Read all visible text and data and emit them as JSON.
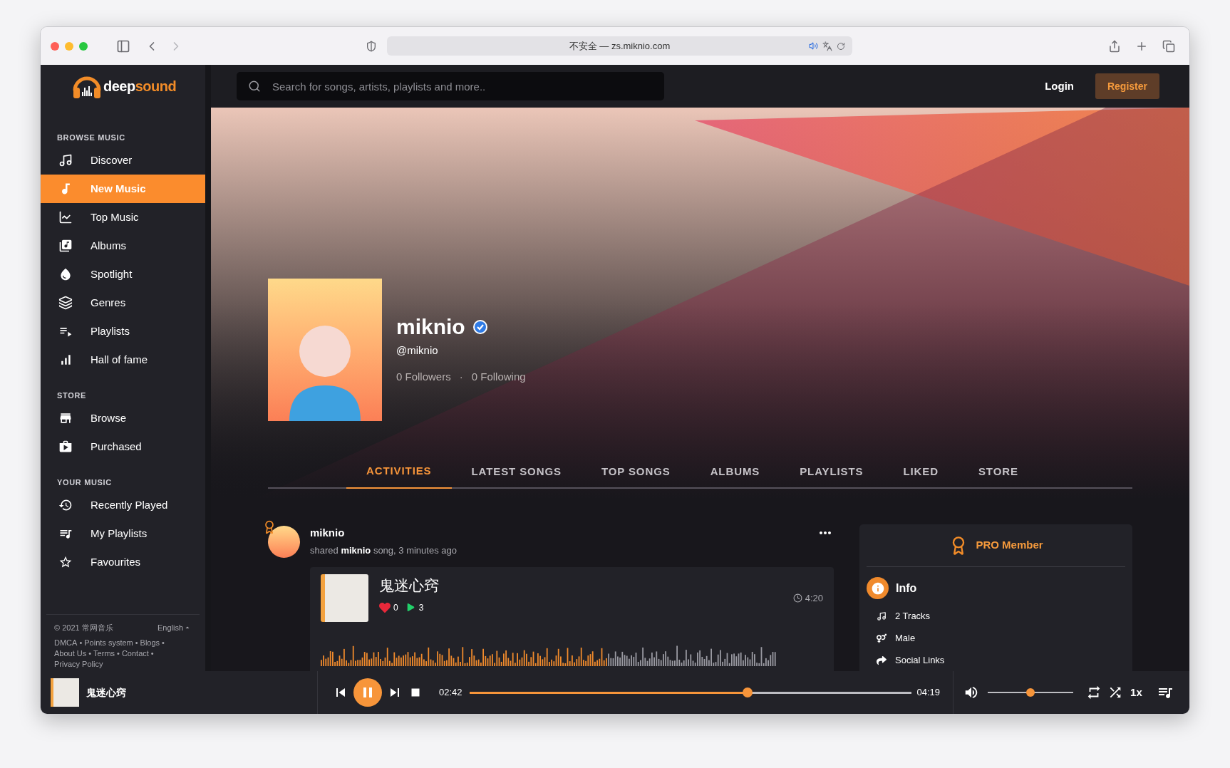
{
  "browser": {
    "address": "不安全 — zs.miknio.com"
  },
  "header": {
    "logo_a": "deep",
    "logo_b": "sound",
    "search": {
      "placeholder": "Search for songs, artists, playlists and more.."
    },
    "login": "Login",
    "register": "Register"
  },
  "sidebar": {
    "sections": [
      {
        "heading": "BROWSE MUSIC",
        "items": [
          {
            "label": "Discover",
            "selected": false
          },
          {
            "label": "New Music",
            "selected": true
          },
          {
            "label": "Top Music",
            "selected": false
          },
          {
            "label": "Albums",
            "selected": false
          },
          {
            "label": "Spotlight",
            "selected": false
          },
          {
            "label": "Genres",
            "selected": false
          },
          {
            "label": "Playlists",
            "selected": false
          },
          {
            "label": "Hall of fame",
            "selected": false
          }
        ]
      },
      {
        "heading": "STORE",
        "items": [
          {
            "label": "Browse",
            "selected": false
          },
          {
            "label": "Purchased",
            "selected": false
          }
        ]
      },
      {
        "heading": "YOUR MUSIC",
        "items": [
          {
            "label": "Recently Played",
            "selected": false
          },
          {
            "label": "My Playlists",
            "selected": false
          },
          {
            "label": "Favourites",
            "selected": false
          }
        ]
      }
    ],
    "footer": {
      "copyright": "© 2021 常网音乐",
      "language": "English",
      "separator": "•",
      "links": [
        "DMCA",
        "Points system",
        "Blogs",
        "About Us",
        "Terms",
        "Contact",
        "Privacy Policy"
      ]
    }
  },
  "profile": {
    "name": "miknio",
    "verified": true,
    "handle": "@miknio",
    "followers": "0 Followers",
    "dot": "·",
    "following": "0 Following"
  },
  "tabs": [
    {
      "label": "ACTIVITIES",
      "selected": true
    },
    {
      "label": "LATEST SONGS",
      "selected": false
    },
    {
      "label": "TOP SONGS",
      "selected": false
    },
    {
      "label": "ALBUMS",
      "selected": false
    },
    {
      "label": "PLAYLISTS",
      "selected": false
    },
    {
      "label": "LIKED",
      "selected": false
    },
    {
      "label": "STORE",
      "selected": false
    }
  ],
  "activity": {
    "user": "miknio",
    "text": "shared **miknio** song, 3 minutes ago",
    "song": {
      "title": "鬼迷心窍",
      "likes": "0",
      "plays": "3",
      "duration": "4:20"
    }
  },
  "pro_panel": {
    "title": "PRO Member",
    "info_heading": "Info",
    "items": [
      "2 Tracks",
      "Male",
      "Social Links"
    ]
  },
  "player": {
    "title": "鬼迷心窍",
    "playing": true,
    "elapsed": "02:42",
    "total": "04:19",
    "level": 0.63,
    "volume": {
      "level": 0.5
    },
    "speed": "1x"
  }
}
